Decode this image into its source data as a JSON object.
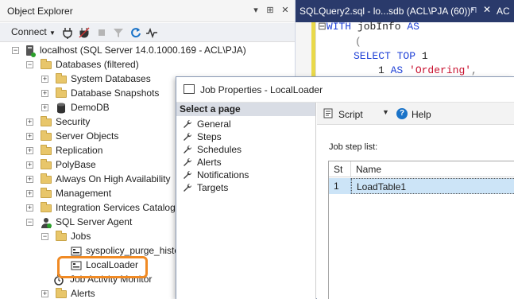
{
  "object_explorer": {
    "title": "Object Explorer",
    "title_controls": [
      "▾",
      "⊞",
      "✕"
    ],
    "toolbar": {
      "connect_label": "Connect",
      "icons": [
        "connect-plug-icon",
        "disconnect-plug-icon",
        "stop-icon",
        "filter-icon",
        "refresh-icon",
        "activity-monitor-icon"
      ]
    },
    "tree": [
      {
        "label": "localhost (SQL Server 14.0.1000.169 - ACL\\PJA)",
        "expander": "−",
        "icon": "server-icon"
      },
      {
        "label": "Databases (filtered)",
        "expander": "−",
        "icon": "folder-icon"
      },
      {
        "label": "System Databases",
        "expander": "+",
        "icon": "folder-icon"
      },
      {
        "label": "Database Snapshots",
        "expander": "+",
        "icon": "folder-icon"
      },
      {
        "label": "DemoDB",
        "expander": "+",
        "icon": "database-icon"
      },
      {
        "label": "Security",
        "expander": "+",
        "icon": "folder-icon"
      },
      {
        "label": "Server Objects",
        "expander": "+",
        "icon": "folder-icon"
      },
      {
        "label": "Replication",
        "expander": "+",
        "icon": "folder-icon"
      },
      {
        "label": "PolyBase",
        "expander": "+",
        "icon": "folder-icon"
      },
      {
        "label": "Always On High Availability",
        "expander": "+",
        "icon": "folder-icon"
      },
      {
        "label": "Management",
        "expander": "+",
        "icon": "folder-icon"
      },
      {
        "label": "Integration Services Catalogs",
        "expander": "+",
        "icon": "folder-icon"
      },
      {
        "label": "SQL Server Agent",
        "expander": "−",
        "icon": "agent-icon"
      },
      {
        "label": "Jobs",
        "expander": "−",
        "icon": "folder-icon"
      },
      {
        "label": "syspolicy_purge_histo",
        "expander": "",
        "icon": "job-icon"
      },
      {
        "label": "LocalLoader",
        "expander": "",
        "icon": "job-icon"
      },
      {
        "label": "Job Activity Monitor",
        "expander": "",
        "icon": "monitor-icon"
      },
      {
        "label": "Alerts",
        "expander": "+",
        "icon": "folder-icon"
      }
    ]
  },
  "query_editor": {
    "tab_title": "SQLQuery2.sql - lo...sdb (ACL\\PJA (60))*",
    "tab_pin": "⊓",
    "tab_close": "✕",
    "next_tab": "AC",
    "lines": {
      "l1_kw": "WITH",
      "l1_rest": " jobInfo ",
      "l1_kw2": "AS",
      "l2": "(",
      "l3_kw": "SELECT TOP",
      "l3_num": " 1",
      "l4_num": "1",
      "l4_kw": " AS ",
      "l4_str": "'Ordering'",
      "l4_end": ","
    }
  },
  "dialog": {
    "title": "Job Properties - LocalLoader",
    "select_page_header": "Select a page",
    "pages": [
      "General",
      "Steps",
      "Schedules",
      "Alerts",
      "Notifications",
      "Targets"
    ],
    "toolbar": {
      "script_label": "Script",
      "dropdown": "▼",
      "help_glyph": "?",
      "help_label": "Help"
    },
    "step_list_label": "Job step list:",
    "grid": {
      "columns": [
        "St",
        "Name"
      ],
      "rows": [
        {
          "step": "1",
          "name": "LoadTable1"
        }
      ]
    }
  }
}
